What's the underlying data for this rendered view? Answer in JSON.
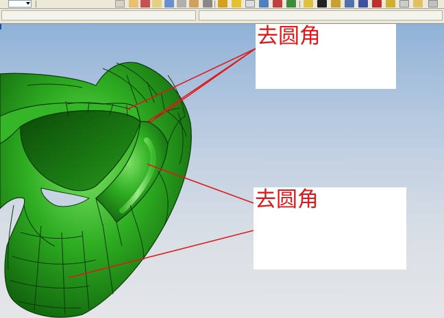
{
  "toolbar": {
    "icons": [
      "part-icon",
      "sketch-icon",
      "rotate-icon",
      "zoom-icon",
      "pan-icon",
      "fit-icon",
      "section-icon",
      "measure-icon",
      "layer-icon",
      "shade-icon",
      "render-icon",
      "camera-icon",
      "axis-icon",
      "view-icon",
      "light-icon",
      "filter-icon",
      "snap-icon",
      "grid-icon"
    ]
  },
  "colors": {
    "model_green": "#27a61c",
    "annotation_red": "#e01818",
    "callout_bg": "#ffffff"
  },
  "annotations": [
    {
      "label": "去圆角"
    },
    {
      "label": "去圆角"
    }
  ]
}
